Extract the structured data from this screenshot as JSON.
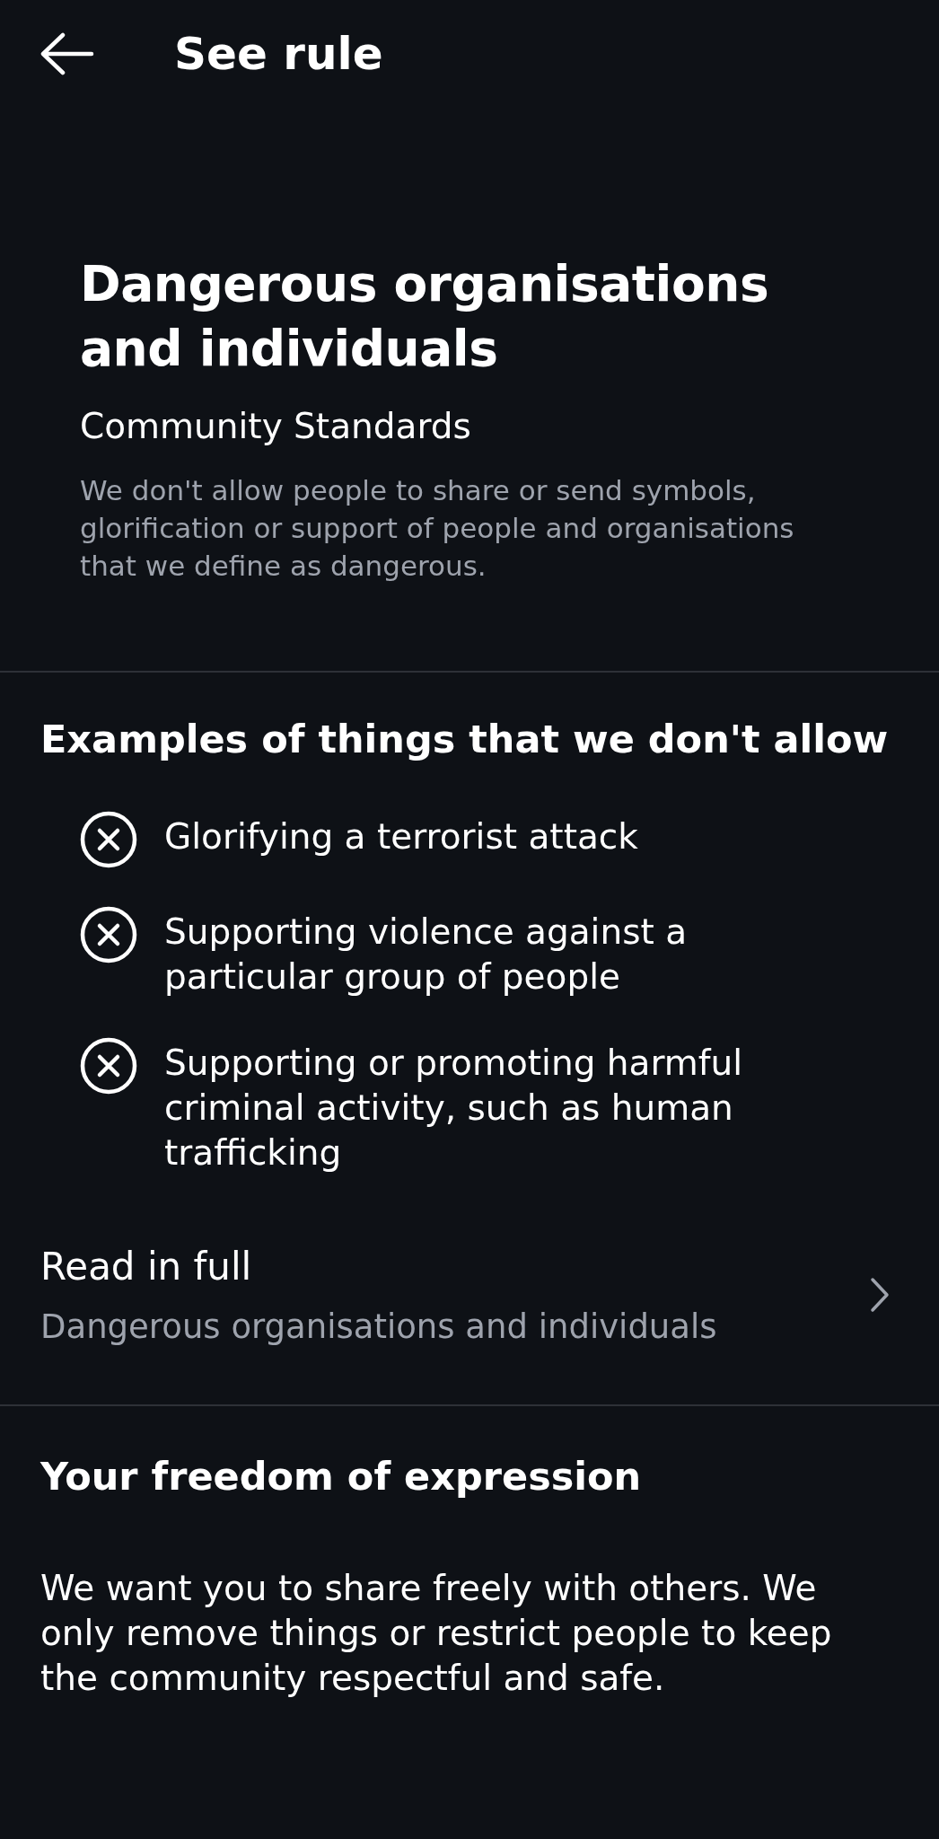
{
  "header": {
    "title": "See rule"
  },
  "rule": {
    "title": "Dangerous organisations and individuals",
    "source": "Community Standards",
    "description": "We don't allow people to share or send symbols, glorification or support of people and organisations that we define as dangerous."
  },
  "examples": {
    "heading": "Examples of things that we don't allow",
    "items": [
      {
        "text": "Glorifying a terrorist attack"
      },
      {
        "text": "Supporting violence against a particular group of people"
      },
      {
        "text": "Supporting or promoting harmful criminal activity, such as human trafficking"
      }
    ]
  },
  "read_in_full": {
    "label": "Read in full",
    "subtitle": "Dangerous organisations and individuals"
  },
  "freedom": {
    "heading": "Your freedom of expression",
    "body": "We want you to share freely with others. We only remove things or restrict people to keep the community respectful and safe."
  }
}
